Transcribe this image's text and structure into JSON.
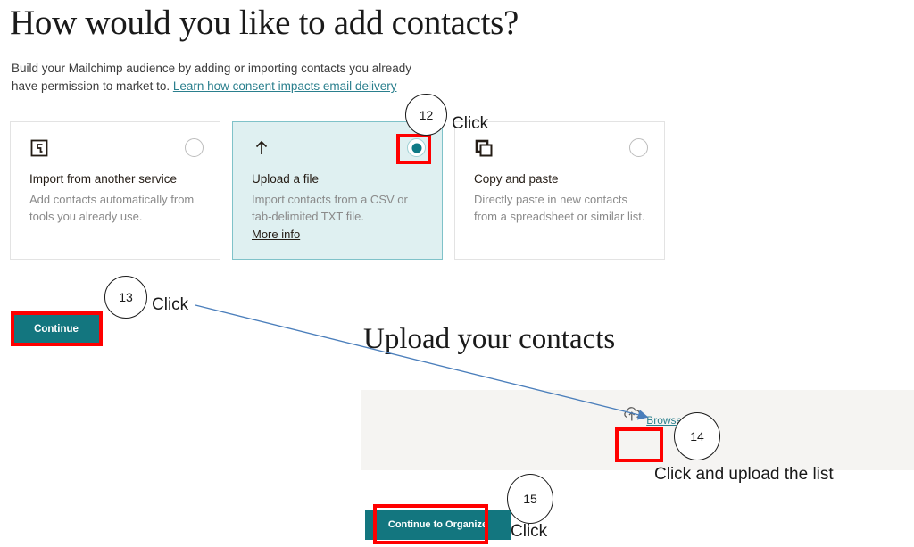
{
  "page": {
    "title": "How would you like to add contacts?",
    "subtitle_text": "Build your Mailchimp audience by adding or importing contacts you already have permission to market to. ",
    "subtitle_link": "Learn how consent impacts email delivery"
  },
  "options": {
    "cards": [
      {
        "icon": "import-service-icon",
        "title": "Import from another service",
        "desc": "Add contacts automatically from tools you already use.",
        "more_info": "",
        "selected": false
      },
      {
        "icon": "upload-arrow-icon",
        "title": "Upload a file",
        "desc": "Import contacts from a CSV or tab-delimited TXT file.",
        "more_info": "More info",
        "selected": true
      },
      {
        "icon": "copy-paste-icon",
        "title": "Copy and paste",
        "desc": "Directly paste in new contacts from a spreadsheet or similar list.",
        "more_info": "",
        "selected": false
      }
    ]
  },
  "actions": {
    "continue_label": "Continue",
    "continue_to_organize_label": "Continue to Organize"
  },
  "upload": {
    "heading": "Upload your contacts",
    "browse_label": "Browse",
    "cloud_icon": "cloud-upload-icon"
  },
  "annotations": {
    "step12": {
      "number": "12",
      "text": "Click"
    },
    "step13": {
      "number": "13",
      "text": "Click"
    },
    "step14": {
      "number": "14",
      "text": "Click and upload the list"
    },
    "step15": {
      "number": "15",
      "text": "Click"
    }
  },
  "colors": {
    "teal_button": "#13767f",
    "selected_card_bg": "#dff0f1",
    "selected_card_border": "#7fc2c9",
    "link": "#2a7f8d",
    "annotation_red": "#ff0000",
    "arrow_blue": "#4a7ebb",
    "dropzone_bg": "#f5f4f2"
  }
}
